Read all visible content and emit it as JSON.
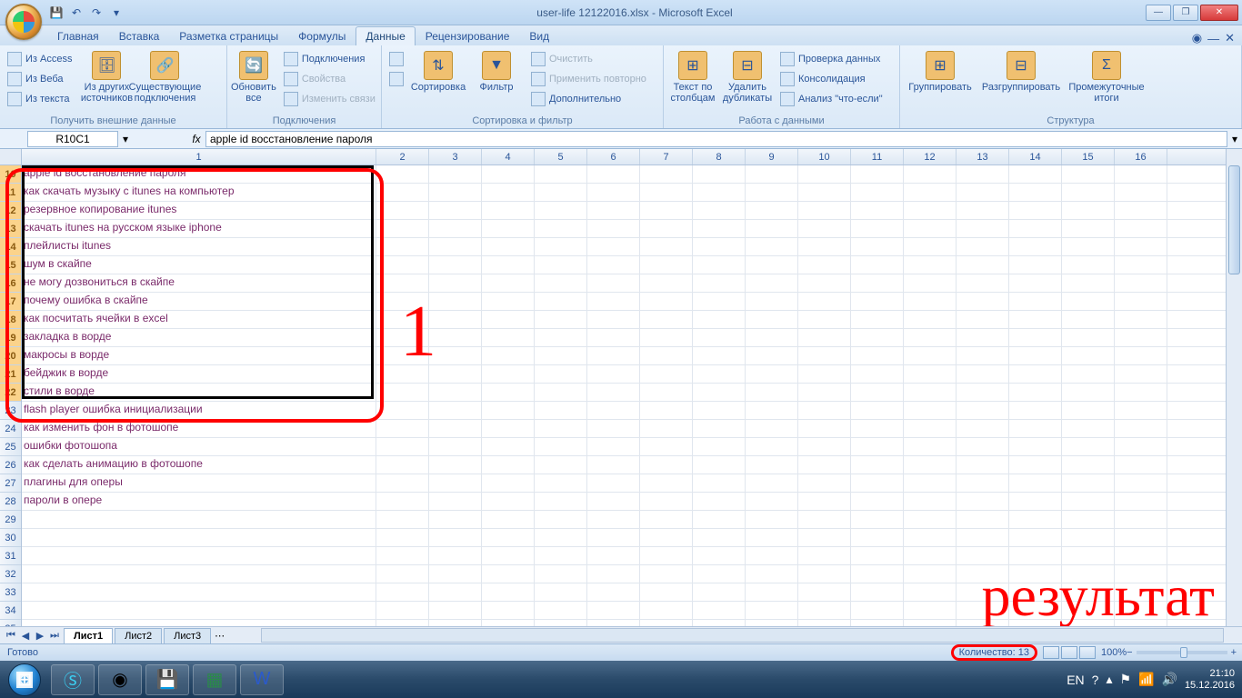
{
  "title": "user-life 12122016.xlsx - Microsoft Excel",
  "tabs": [
    "Главная",
    "Вставка",
    "Разметка страницы",
    "Формулы",
    "Данные",
    "Рецензирование",
    "Вид"
  ],
  "active_tab": "Данные",
  "ribbon": {
    "g1": {
      "label": "Получить внешние данные",
      "access": "Из Access",
      "web": "Из Веба",
      "text": "Из текста",
      "other": "Из других источников",
      "existing": "Существующие подключения"
    },
    "g2": {
      "label": "Подключения",
      "refresh": "Обновить все",
      "conn": "Подключения",
      "props": "Свойства",
      "edit": "Изменить связи"
    },
    "g3": {
      "label": "Сортировка и фильтр",
      "az": "А↓Я",
      "za": "Я↓А",
      "sort": "Сортировка",
      "filter": "Фильтр",
      "clear": "Очистить",
      "reapply": "Применить повторно",
      "advanced": "Дополнительно"
    },
    "g4": {
      "label": "Работа с данными",
      "ttc": "Текст по столбцам",
      "dedup": "Удалить дубликаты",
      "valid": "Проверка данных",
      "consol": "Консолидация",
      "whatif": "Анализ \"что-если\""
    },
    "g5": {
      "label": "Структура",
      "group": "Группировать",
      "ungroup": "Разгруппировать",
      "subtotal": "Промежуточные итоги"
    }
  },
  "namebox": "R10C1",
  "formula": "apple id восстановление пароля",
  "col_widths": {
    "c1": 390,
    "rest": 58
  },
  "first_row": 10,
  "selected_rows": [
    10,
    22
  ],
  "rows": [
    "apple id восстановление пароля",
    "как скачать музыку с itunes на компьютер",
    "резервное копирование itunes",
    "скачать itunes на русском языке iphone",
    "плейлисты itunes",
    "шум в скайпе",
    "не могу дозвониться в скайпе",
    "почему ошибка в скайпе",
    "как посчитать ячейки в excel",
    "закладка в ворде",
    "макросы в ворде",
    "бейджик в ворде",
    "стили в ворде",
    "flash player ошибка инициализации",
    "как изменить фон в фотошопе",
    "ошибки фотошопа",
    "как сделать анимацию в фотошопе",
    "плагины для  оперы",
    "пароли в опере",
    "",
    "",
    "",
    "",
    "",
    "",
    ""
  ],
  "column_numbers": [
    1,
    2,
    3,
    4,
    5,
    6,
    7,
    8,
    9,
    10,
    11,
    12,
    13,
    14,
    15,
    16
  ],
  "annotations": {
    "n1": "1",
    "result": "результат"
  },
  "sheets": [
    "Лист1",
    "Лист2",
    "Лист3"
  ],
  "active_sheet": "Лист1",
  "status": {
    "ready": "Готово",
    "count": "Количество: 13",
    "zoom": "100%"
  },
  "tray": {
    "lang": "EN",
    "time": "21:10",
    "date": "15.12.2016"
  }
}
